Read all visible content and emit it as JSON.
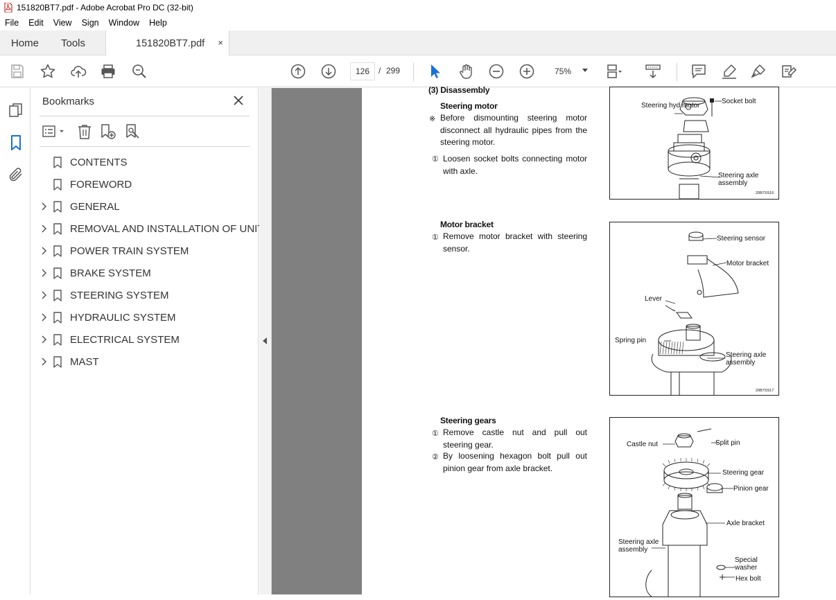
{
  "window": {
    "title": "151820BT7.pdf - Adobe Acrobat Pro DC (32-bit)"
  },
  "menu": [
    "File",
    "Edit",
    "View",
    "Sign",
    "Window",
    "Help"
  ],
  "tabs": {
    "home": "Home",
    "tools": "Tools",
    "document": "151820BT7.pdf",
    "close": "×"
  },
  "toolbar": {
    "page_current": "126",
    "page_sep": "/",
    "page_total": "299",
    "zoom": "75%"
  },
  "bookmarks_panel": {
    "title": "Bookmarks",
    "items": [
      {
        "label": "CONTENTS",
        "expandable": false
      },
      {
        "label": "FOREWORD",
        "expandable": false
      },
      {
        "label": "GENERAL",
        "expandable": true
      },
      {
        "label": "REMOVAL AND INSTALLATION OF UNIT",
        "expandable": true
      },
      {
        "label": "POWER TRAIN SYSTEM",
        "expandable": true
      },
      {
        "label": "BRAKE SYSTEM",
        "expandable": true
      },
      {
        "label": "STEERING SYSTEM",
        "expandable": true
      },
      {
        "label": "HYDRAULIC SYSTEM",
        "expandable": true
      },
      {
        "label": "ELECTRICAL SYSTEM",
        "expandable": true
      },
      {
        "label": "MAST",
        "expandable": true
      }
    ]
  },
  "document": {
    "section_heading": "(3) Disassembly",
    "blocks": [
      {
        "title": "Steering motor",
        "steps": [
          {
            "mark": "※",
            "text": "Before dismounting steering motor disconnect all hydraulic pipes from the steering motor."
          },
          {
            "mark": "①",
            "text": "Loosen socket bolts connecting motor with axle."
          }
        ],
        "figure": {
          "code": "20B7SS16",
          "labels": [
            "Steering hyd motor",
            "Socket bolt",
            "Steering axle assembly"
          ]
        }
      },
      {
        "title": "Motor bracket",
        "steps": [
          {
            "mark": "①",
            "text": "Remove motor bracket with steering sensor."
          }
        ],
        "figure": {
          "code": "20B7SS17",
          "labels": [
            "Steering sensor",
            "Motor bracket",
            "Lever",
            "Spring pin",
            "Steering axle assembly"
          ]
        }
      },
      {
        "title": "Steering gears",
        "steps": [
          {
            "mark": "①",
            "text": "Remove castle nut and pull out steering gear."
          },
          {
            "mark": "②",
            "text": "By loosening hexagon bolt pull out pinion gear from axle bracket."
          }
        ],
        "figure": {
          "labels": [
            "Castle nut",
            "Split pin",
            "Steering gear",
            "Pinion gear",
            "Axle bracket",
            "Steering axle assembly",
            "Special washer",
            "Hex bolt"
          ]
        }
      }
    ]
  }
}
